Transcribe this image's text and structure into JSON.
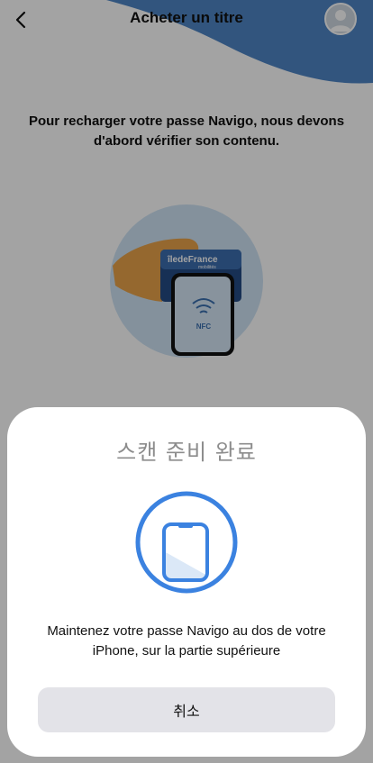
{
  "header": {
    "title": "Acheter un titre",
    "back_icon": "chevron-left-icon",
    "avatar_icon": "user-avatar-icon"
  },
  "main": {
    "intro_text": "Pour recharger votre passe Navigo, nous devons d'abord vérifier son contenu.",
    "card_brand": "îledeFrance",
    "card_brand_sub": "mobilités",
    "nfc_label": "NFC"
  },
  "scan_sheet": {
    "title": "스캔 준비 완료",
    "instruction": "Maintenez votre passe Navigo au dos de votre iPhone, sur la partie supérieure",
    "cancel_label": "취소"
  },
  "colors": {
    "accent_blue": "#3b82e0",
    "header_wave_blue": "#4f86c6",
    "sheet_background": "#ffffff",
    "cancel_background": "#e3e3e8"
  }
}
